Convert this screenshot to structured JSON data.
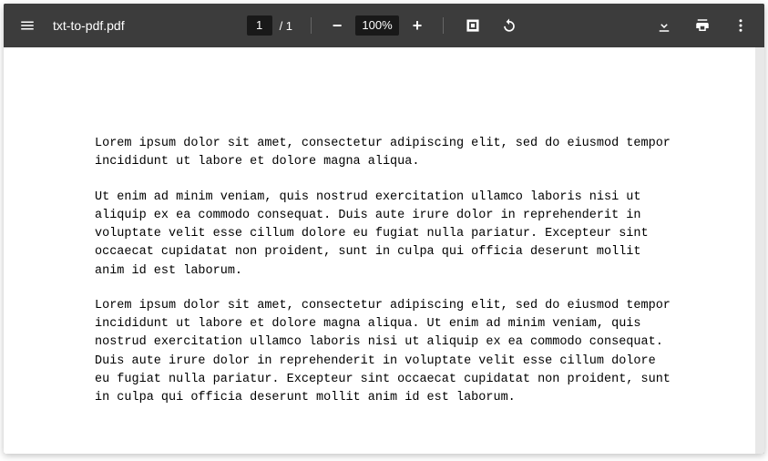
{
  "toolbar": {
    "filename": "txt-to-pdf.pdf",
    "page_current": "1",
    "page_total": "/ 1",
    "zoom_minus": "−",
    "zoom_level": "100%",
    "zoom_plus": "+"
  },
  "document": {
    "paragraphs": [
      "Lorem ipsum dolor sit amet, consectetur adipiscing elit, sed do eiusmod tempor incididunt ut labore et dolore magna aliqua.",
      "Ut enim ad minim veniam, quis nostrud exercitation ullamco laboris nisi ut aliquip ex ea commodo consequat. Duis aute irure dolor in reprehenderit in voluptate velit esse cillum dolore eu fugiat nulla pariatur. Excepteur sint occaecat cupidatat non proident, sunt in culpa qui officia deserunt mollit anim id est laborum.",
      "Lorem ipsum dolor sit amet, consectetur adipiscing elit, sed do eiusmod tempor incididunt ut labore et dolore magna aliqua. Ut enim ad minim veniam, quis nostrud exercitation ullamco laboris nisi ut aliquip ex ea commodo consequat. Duis aute irure dolor in reprehenderit in voluptate velit esse cillum dolore eu fugiat nulla pariatur. Excepteur sint occaecat cupidatat non proident, sunt in culpa qui officia deserunt mollit anim id est laborum."
    ]
  }
}
